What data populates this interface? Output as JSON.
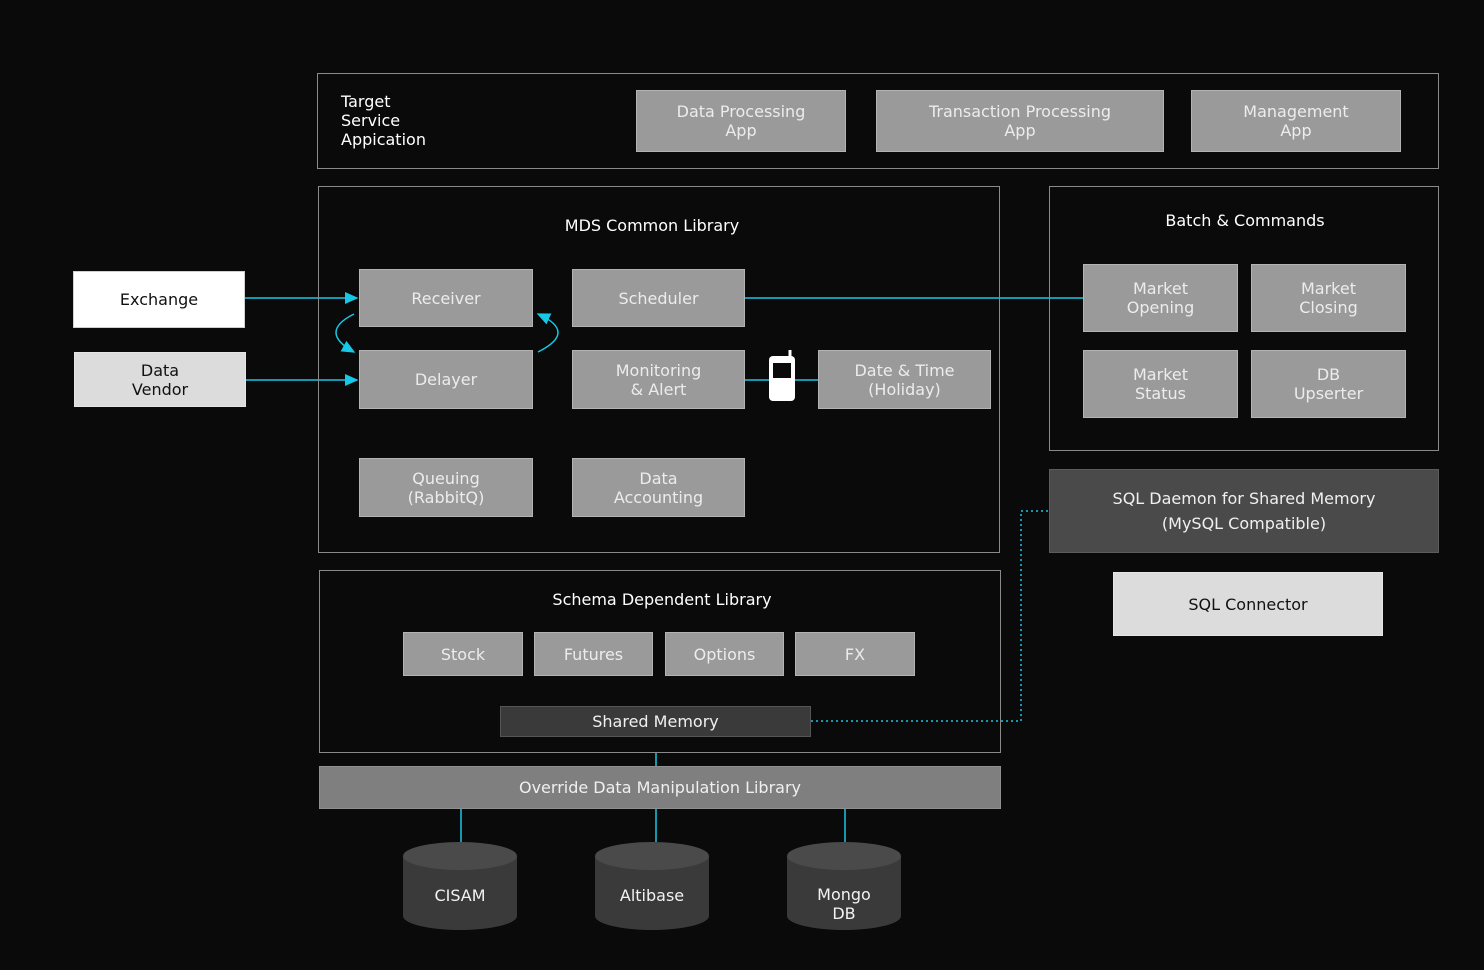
{
  "target": {
    "label": "Target\nService\nAppication",
    "apps": [
      "Data Processing\nApp",
      "Transaction Processing\nApp",
      "Management\nApp"
    ]
  },
  "mds": {
    "title": "MDS Common Library",
    "receiver": "Receiver",
    "scheduler": "Scheduler",
    "delayer": "Delayer",
    "monitoring": "Monitoring\n& Alert",
    "datetime": "Date & Time\n(Holiday)",
    "queuing": "Queuing\n(RabbitQ)",
    "accounting": "Data\nAccounting"
  },
  "sources": {
    "exchange": "Exchange",
    "vendor": "Data\nVendor"
  },
  "batch": {
    "title": "Batch & Commands",
    "opening": "Market\nOpening",
    "closing": "Market\nClosing",
    "status": "Market\nStatus",
    "upserter": "DB\nUpserter"
  },
  "sql": {
    "daemon": "SQL Daemon for Shared Memory\n(MySQL Compatible)",
    "connector": "SQL Connector"
  },
  "schema": {
    "title": "Schema Dependent Library",
    "items": [
      "Stock",
      "Futures",
      "Options",
      "FX"
    ],
    "shared": "Shared Memory"
  },
  "override": "Override Data Manipulation Library",
  "databases": [
    "CISAM",
    "Altibase",
    "Mongo\nDB"
  ],
  "colors": {
    "connector": "#16c8e6"
  }
}
